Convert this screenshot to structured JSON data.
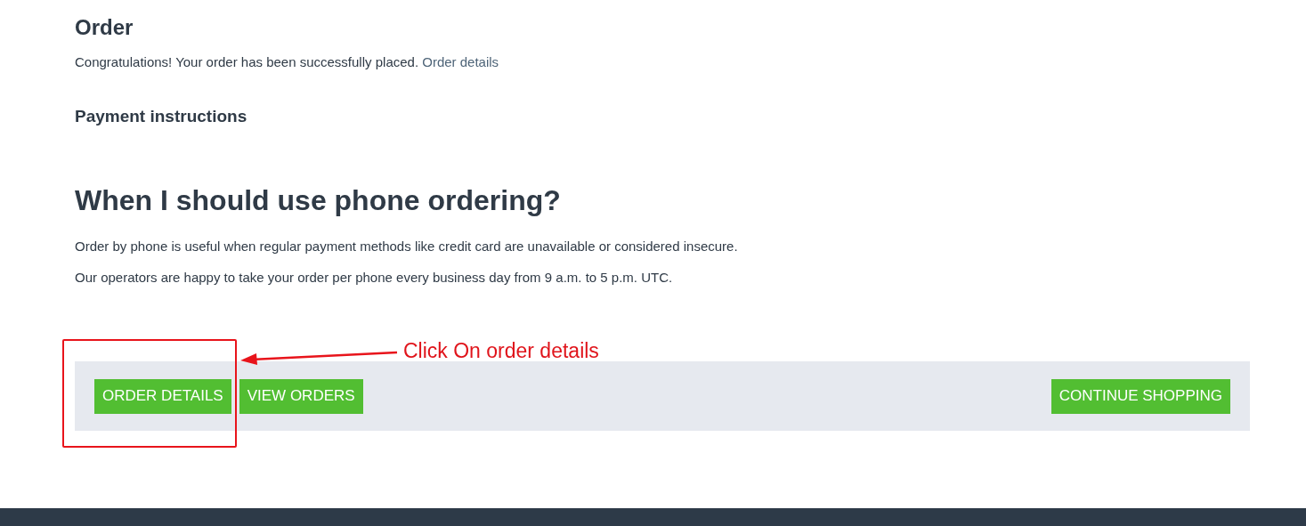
{
  "order": {
    "title": "Order",
    "message": "Congratulations! Your order has been successfully placed.",
    "link": "Order details"
  },
  "payment": {
    "title": "Payment instructions"
  },
  "info": {
    "title": "When I should use phone ordering?",
    "paragraphs": [
      "Order by phone is useful when regular payment methods like credit card are unavailable or considered insecure.",
      "Our operators are happy to take your order per phone every business day from 9 a.m. to 5 p.m. UTC."
    ]
  },
  "actions": {
    "left": [
      "ORDER DETAILS",
      "VIEW ORDERS"
    ],
    "right": [
      "CONTINUE SHOPPING"
    ]
  },
  "annotation": {
    "text": "Click On order details"
  }
}
